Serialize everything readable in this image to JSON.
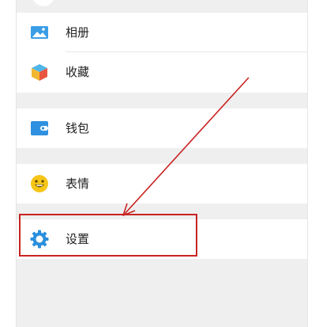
{
  "menu": {
    "items": [
      {
        "label": "相册",
        "icon": "photo-album-icon"
      },
      {
        "label": "收藏",
        "icon": "favorites-cube-icon"
      },
      {
        "label": "钱包",
        "icon": "wallet-icon"
      },
      {
        "label": "表情",
        "icon": "smiley-emoji-icon"
      },
      {
        "label": "设置",
        "icon": "settings-gear-icon"
      }
    ]
  },
  "colors": {
    "album_blue": "#3a9ee6",
    "wallet_blue": "#2e90e0",
    "gear_blue": "#2a8fdc",
    "emoji_yellow": "#f5c518",
    "annotation_red": "#c82322",
    "separator_gray": "#efefef"
  }
}
